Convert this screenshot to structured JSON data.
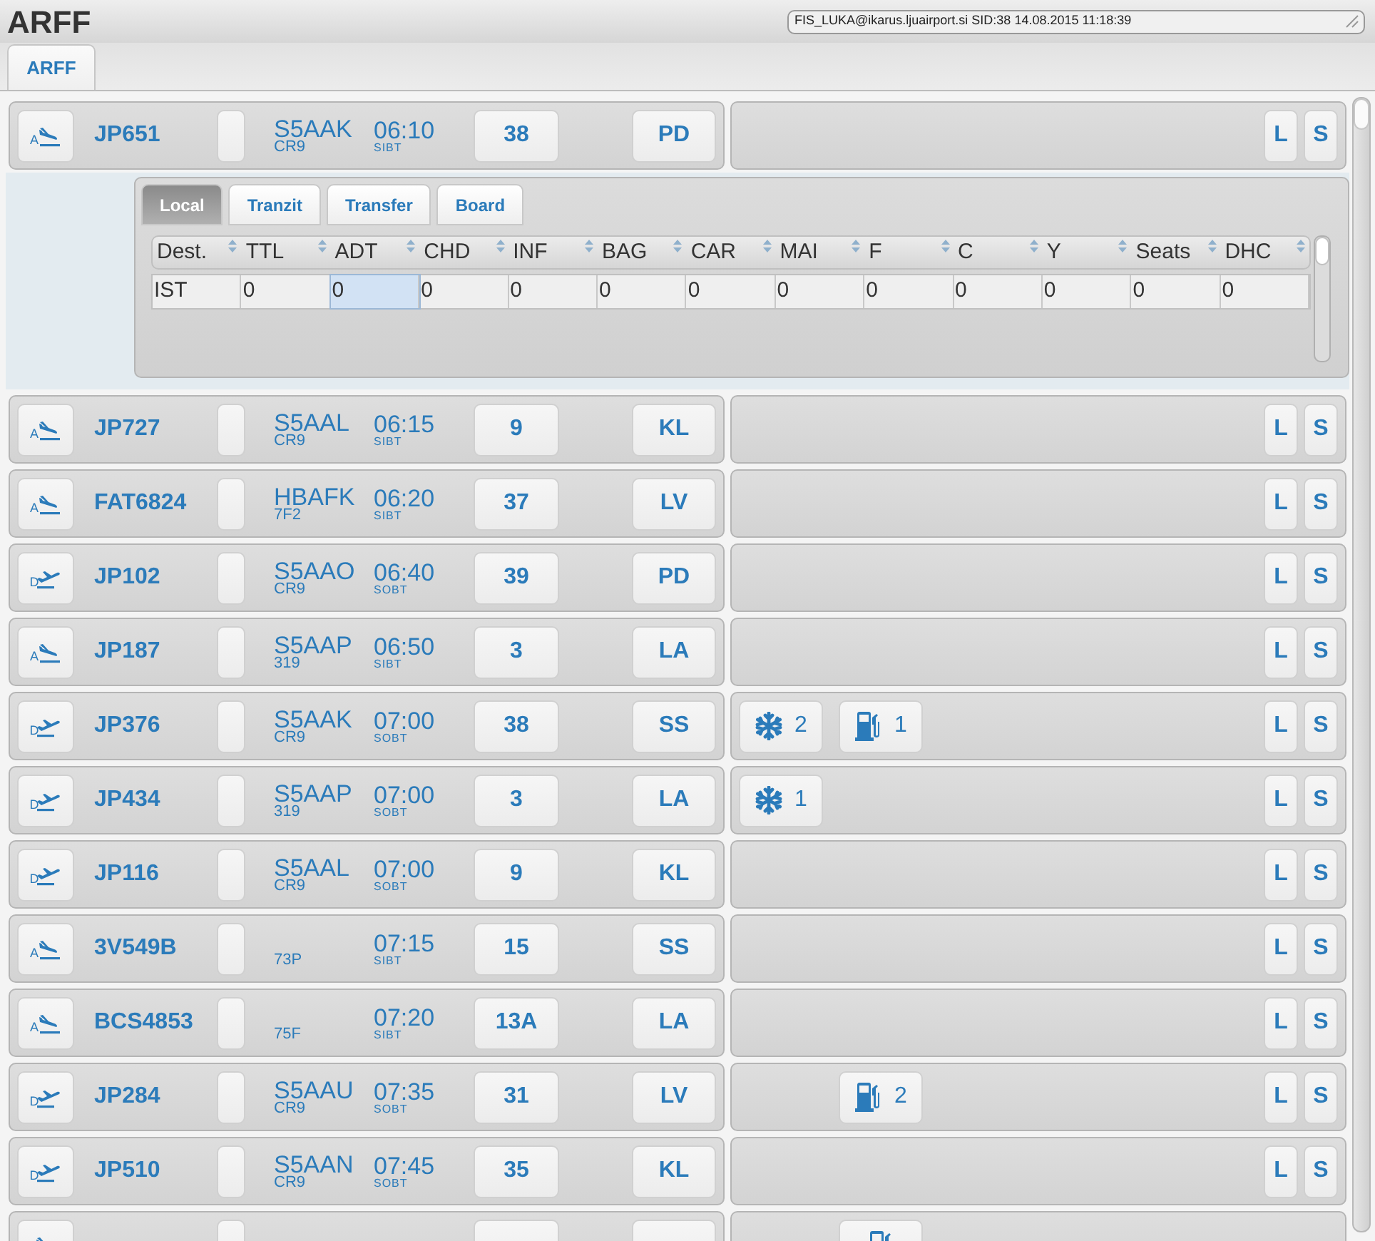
{
  "header": {
    "title": "ARFF",
    "session": "FIS_LUKA@ikarus.ljuairport.si SID:38 14.08.2015 11:18:39"
  },
  "tabs": [
    {
      "label": "ARFF",
      "selected": true
    }
  ],
  "flights": [
    {
      "kind": "arrival",
      "dir_letter": "A",
      "flight": "JP651",
      "registration": "S5AAK",
      "type": "CR9",
      "time": "06:10",
      "time_label": "SIBT",
      "gate": "38",
      "stand": "PD",
      "buttons": [
        "L",
        "S"
      ],
      "detail": {
        "tabs": [
          {
            "label": "Local",
            "selected": true
          },
          {
            "label": "Tranzit",
            "selected": false
          },
          {
            "label": "Transfer",
            "selected": false
          },
          {
            "label": "Board",
            "selected": false
          }
        ],
        "columns": [
          "Dest.",
          "TTL",
          "ADT",
          "CHD",
          "INF",
          "BAG",
          "CAR",
          "MAI",
          "F",
          "C",
          "Y",
          "Seats",
          "DHC"
        ],
        "rows": [
          [
            {
              "text": "IST",
              "selected": false
            },
            {
              "text": "0",
              "selected": false
            },
            {
              "text": "0",
              "selected": true
            },
            {
              "text": "0",
              "selected": false
            },
            {
              "text": "0",
              "selected": false
            },
            {
              "text": "0",
              "selected": false
            },
            {
              "text": "0",
              "selected": false
            },
            {
              "text": "0",
              "selected": false
            },
            {
              "text": "0",
              "selected": false
            },
            {
              "text": "0",
              "selected": false
            },
            {
              "text": "0",
              "selected": false
            },
            {
              "text": "0",
              "selected": false
            },
            {
              "text": "0",
              "selected": false
            }
          ]
        ]
      }
    },
    {
      "kind": "arrival",
      "dir_letter": "A",
      "flight": "JP727",
      "registration": "S5AAL",
      "type": "CR9",
      "time": "06:15",
      "time_label": "SIBT",
      "gate": "9",
      "stand": "KL",
      "buttons": [
        "L",
        "S"
      ]
    },
    {
      "kind": "arrival",
      "dir_letter": "A",
      "flight": "FAT6824",
      "registration": "HBAFK",
      "type": "7F2",
      "time": "06:20",
      "time_label": "SIBT",
      "gate": "37",
      "stand": "LV",
      "buttons": [
        "L",
        "S"
      ]
    },
    {
      "kind": "departure",
      "dir_letter": "D",
      "flight": "JP102",
      "registration": "S5AAO",
      "type": "CR9",
      "time": "06:40",
      "time_label": "SOBT",
      "gate": "39",
      "stand": "PD",
      "buttons": [
        "L",
        "S"
      ]
    },
    {
      "kind": "arrival",
      "dir_letter": "A",
      "flight": "JP187",
      "registration": "S5AAP",
      "type": "319",
      "time": "06:50",
      "time_label": "SIBT",
      "gate": "3",
      "stand": "LA",
      "buttons": [
        "L",
        "S"
      ]
    },
    {
      "kind": "departure",
      "dir_letter": "D",
      "flight": "JP376",
      "registration": "S5AAK",
      "type": "CR9",
      "time": "07:00",
      "time_label": "SOBT",
      "gate": "38",
      "stand": "SS",
      "services": [
        {
          "kind": "deicing",
          "count": "2"
        },
        {
          "kind": "fuel",
          "count": "1"
        }
      ],
      "buttons": [
        "L",
        "S"
      ]
    },
    {
      "kind": "departure",
      "dir_letter": "D",
      "flight": "JP434",
      "registration": "S5AAP",
      "type": "319",
      "time": "07:00",
      "time_label": "SOBT",
      "gate": "3",
      "stand": "LA",
      "services": [
        {
          "kind": "deicing",
          "count": "1"
        }
      ],
      "buttons": [
        "L",
        "S"
      ]
    },
    {
      "kind": "departure",
      "dir_letter": "D",
      "flight": "JP116",
      "registration": "S5AAL",
      "type": "CR9",
      "time": "07:00",
      "time_label": "SOBT",
      "gate": "9",
      "stand": "KL",
      "buttons": [
        "L",
        "S"
      ]
    },
    {
      "kind": "arrival",
      "dir_letter": "A",
      "flight": "3V549B",
      "type": "73P",
      "time": "07:15",
      "time_label": "SIBT",
      "gate": "15",
      "stand": "SS",
      "buttons": [
        "L",
        "S"
      ]
    },
    {
      "kind": "arrival",
      "dir_letter": "A",
      "flight": "BCS4853",
      "type": "75F",
      "time": "07:20",
      "time_label": "SIBT",
      "gate": "13A",
      "stand": "LA",
      "buttons": [
        "L",
        "S"
      ]
    },
    {
      "kind": "departure",
      "dir_letter": "D",
      "flight": "JP284",
      "registration": "S5AAU",
      "type": "CR9",
      "time": "07:35",
      "time_label": "SOBT",
      "gate": "31",
      "stand": "LV",
      "services": [
        {
          "kind": "fuel",
          "count": "2"
        }
      ],
      "buttons": [
        "L",
        "S"
      ]
    },
    {
      "kind": "departure",
      "dir_letter": "D",
      "flight": "JP510",
      "registration": "S5AAN",
      "type": "CR9",
      "time": "07:45",
      "time_label": "SOBT",
      "gate": "35",
      "stand": "KL",
      "buttons": [
        "L",
        "S"
      ]
    },
    {
      "kind": "arrival",
      "services": [
        {
          "kind": "fuel"
        }
      ]
    }
  ]
}
